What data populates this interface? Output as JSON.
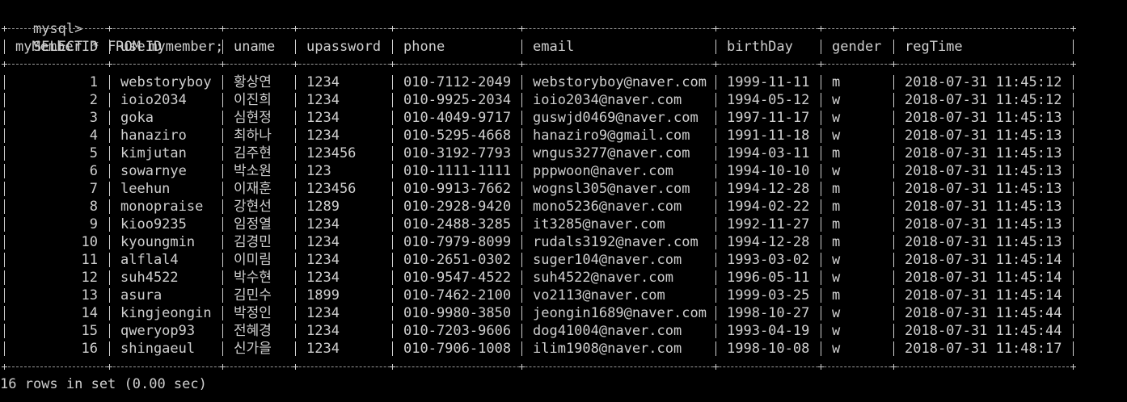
{
  "prompt": "mysql>",
  "command": "SELECT * FROM mymember;",
  "columns": [
    "myMemberID",
    "useID",
    "uname",
    "upassword",
    "phone",
    "email",
    "birthDay",
    "gender",
    "regTime"
  ],
  "rows": [
    [
      "1",
      "webstoryboy",
      "황상연",
      "1234",
      "010-7112-2049",
      "webstoryboy@naver.com",
      "1999-11-11",
      "m",
      "2018-07-31 11:45:12"
    ],
    [
      "2",
      "ioio2034",
      "이진희",
      "1234",
      "010-9925-2034",
      "ioio2034@naver.com",
      "1994-05-12",
      "w",
      "2018-07-31 11:45:12"
    ],
    [
      "3",
      "goka",
      "심현정",
      "1234",
      "010-4049-9717",
      "guswjd0469@naver.com",
      "1997-11-17",
      "w",
      "2018-07-31 11:45:13"
    ],
    [
      "4",
      "hanaziro",
      "최하나",
      "1234",
      "010-5295-4668",
      "hanaziro9@gmail.com",
      "1991-11-18",
      "w",
      "2018-07-31 11:45:13"
    ],
    [
      "5",
      "kimjutan",
      "김주현",
      "123456",
      "010-3192-7793",
      "wngus3277@naver.com",
      "1994-03-11",
      "m",
      "2018-07-31 11:45:13"
    ],
    [
      "6",
      "sowarnye",
      "박소원",
      "123",
      "010-1111-1111",
      "pppwoon@naver.com",
      "1994-10-10",
      "w",
      "2018-07-31 11:45:13"
    ],
    [
      "7",
      "leehun",
      "이재훈",
      "123456",
      "010-9913-7662",
      "wognsl305@naver.com",
      "1994-12-28",
      "m",
      "2018-07-31 11:45:13"
    ],
    [
      "8",
      "monopraise",
      "강현선",
      "1289",
      "010-2928-9420",
      "mono5236@naver.com",
      "1994-02-22",
      "m",
      "2018-07-31 11:45:13"
    ],
    [
      "9",
      "kioo9235",
      "임정열",
      "1234",
      "010-2488-3285",
      "it3285@naver.com",
      "1992-11-27",
      "m",
      "2018-07-31 11:45:13"
    ],
    [
      "10",
      "kyoungmin",
      "김경민",
      "1234",
      "010-7979-8099",
      "rudals3192@naver.com",
      "1994-12-28",
      "m",
      "2018-07-31 11:45:13"
    ],
    [
      "11",
      "alflal4",
      "이미림",
      "1234",
      "010-2651-0302",
      "suger104@naver.com",
      "1993-03-02",
      "w",
      "2018-07-31 11:45:14"
    ],
    [
      "12",
      "suh4522",
      "박수현",
      "1234",
      "010-9547-4522",
      "suh4522@naver.com",
      "1996-05-11",
      "w",
      "2018-07-31 11:45:14"
    ],
    [
      "13",
      "asura",
      "김민수",
      "1899",
      "010-7462-2100",
      "vo2113@naver.com",
      "1999-03-25",
      "m",
      "2018-07-31 11:45:14"
    ],
    [
      "14",
      "kingjeongin",
      "박정인",
      "1234",
      "010-9980-3850",
      "jeongin1689@naver.com",
      "1998-10-27",
      "w",
      "2018-07-31 11:45:44"
    ],
    [
      "15",
      "qweryop93",
      "전혜경",
      "1234",
      "010-7203-9606",
      "dog41004@naver.com",
      "1993-04-19",
      "w",
      "2018-07-31 11:45:44"
    ],
    [
      "16",
      "shingaeul",
      "신가을",
      "1234",
      "010-7906-1008",
      "ilim1908@naver.com",
      "1998-10-08",
      "w",
      "2018-07-31 11:48:17"
    ]
  ],
  "footer": "16 rows in set (0.00 sec)"
}
